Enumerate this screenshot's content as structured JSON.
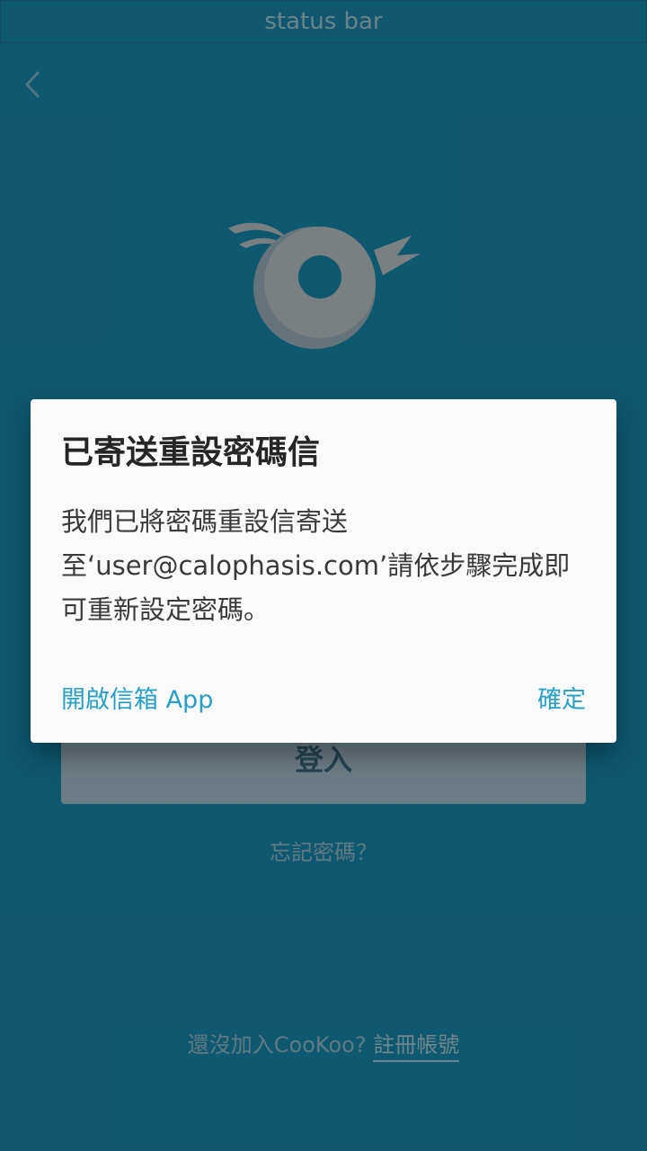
{
  "status_bar": {
    "label": "status bar"
  },
  "login": {
    "button_label": "登入",
    "forgot_password": "忘記密碼？",
    "signup_prompt": "還沒加入CooKoo? ",
    "signup_link": "註冊帳號"
  },
  "dialog": {
    "title": "已寄送重設密碼信",
    "message": "我們已將密碼重設信寄送至‘user@calophasis.com’請依步驟完成即可重新設定密碼。",
    "open_mail_app": "開啟信箱 App",
    "confirm": "確定"
  },
  "colors": {
    "background": "#105f78",
    "accent": "#27a0c9",
    "dialog_bg": "#fafafa"
  },
  "icons": {
    "back": "chevron-left-icon",
    "logo": "cookoo-logo"
  }
}
